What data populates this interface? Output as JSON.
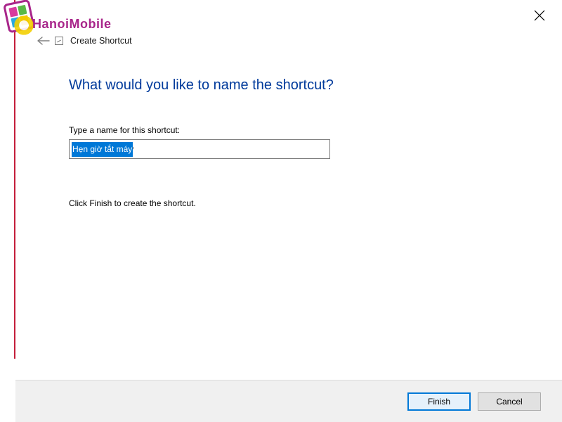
{
  "watermark": {
    "brand": "HanoiMobile"
  },
  "window": {
    "wizard_title": "Create Shortcut"
  },
  "content": {
    "heading": "What would you like to name the shortcut?",
    "name_label": "Type a name for this shortcut:",
    "name_value": "Hẹn giờ tắt máy",
    "hint": "Click Finish to create the shortcut."
  },
  "buttons": {
    "finish": "Finish",
    "cancel": "Cancel"
  }
}
